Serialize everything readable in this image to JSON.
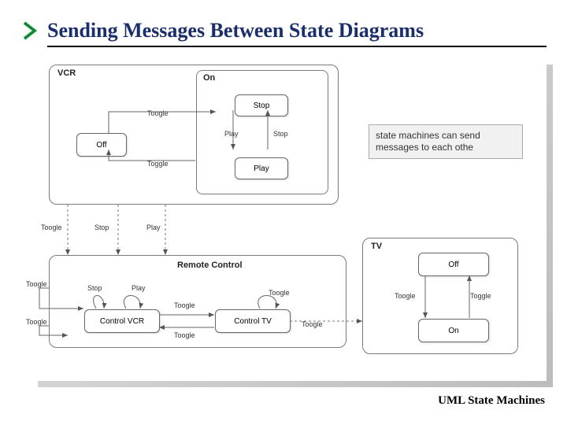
{
  "title": "Sending Messages Between State Diagrams",
  "footer": "UML State Machines",
  "note": {
    "line1": "state machines can send",
    "line2": "messages to each othe"
  },
  "vcr": {
    "title": "VCR",
    "on_title": "On",
    "states": {
      "off": "Off",
      "stop": "Stop",
      "play": "Play"
    },
    "edges": {
      "toggle_off_to_stop": "Toogle",
      "toggle_stop_to_off": "Toggle",
      "play_down": "Play",
      "stop_up": "Stop"
    }
  },
  "remote": {
    "title": "Remote Control",
    "states": {
      "control_vcr": "Control VCR",
      "control_tv": "Control TV"
    },
    "edges": {
      "toggle_top": "Toogle",
      "toggle_bottom": "Toogle",
      "toggle_left_up": "Toogle",
      "toggle_left_down": "Toogle",
      "stop_self": "Stop",
      "play_self": "Play",
      "toggle_tv_self": "Toogle",
      "toggle_out": "Toogle"
    }
  },
  "tv": {
    "title": "TV",
    "states": {
      "off": "Off",
      "on": "On"
    },
    "edges": {
      "toggle_down": "Toogle",
      "toggle_up": "Toggle"
    }
  },
  "bridges": {
    "toggle": "Toogle",
    "stop": "Stop",
    "play": "Play"
  }
}
